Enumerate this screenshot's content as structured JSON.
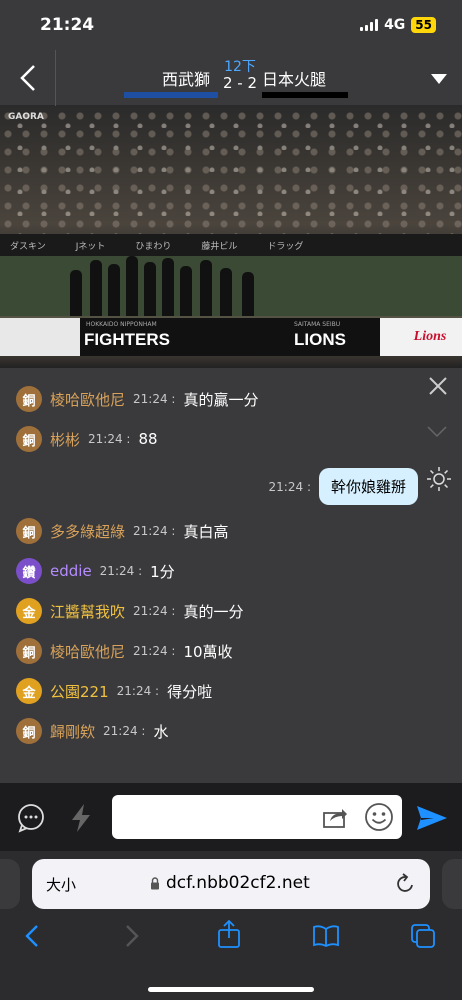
{
  "status": {
    "time": "21:24",
    "network": "4G",
    "battery": "55"
  },
  "header": {
    "inning": "12下",
    "score": "2 - 2",
    "home_team": "西武獅",
    "away_team": "日本火腿",
    "colors": {
      "home_bar": "#1e4fa3",
      "away_bar": "#000000",
      "inning": "#4da6ff"
    }
  },
  "video": {
    "broadcaster": "GAORA",
    "ads": [
      "ダスキン",
      "Jネット",
      "ひまわり",
      "藤井ビル",
      "ドラッグ"
    ],
    "scorebug": {
      "home_sub": "HOKKAIDO NIPPONHAM",
      "home": "FIGHTERS",
      "away_sub": "SAITAMA SEIBU",
      "away": "LIONS",
      "logo": "Lions"
    }
  },
  "chat": {
    "messages": [
      {
        "badge": "銅",
        "badge_color": "#a0703a",
        "user": "棱哈歐他尼",
        "user_color": "#d8a25a",
        "time": "21:24",
        "text": "真的贏一分"
      },
      {
        "badge": "銅",
        "badge_color": "#a0703a",
        "user": "彬彬",
        "user_color": "#d8a25a",
        "time": "21:24",
        "text": "88"
      },
      {
        "badge": "銅",
        "badge_color": "#a0703a",
        "user": "多多綠超綠",
        "user_color": "#d8a25a",
        "time": "21:24",
        "text": "真白高"
      },
      {
        "badge": "鑽",
        "badge_color": "#7b4fc9",
        "user": "eddie",
        "user_color": "#b48cff",
        "time": "21:24",
        "text": "1分"
      },
      {
        "badge": "金",
        "badge_color": "#e0a020",
        "user": "江醬幫我吹",
        "user_color": "#f0c040",
        "time": "21:24",
        "text": "真的一分"
      },
      {
        "badge": "銅",
        "badge_color": "#a0703a",
        "user": "棱哈歐他尼",
        "user_color": "#d8a25a",
        "time": "21:24",
        "text": "10萬收"
      },
      {
        "badge": "金",
        "badge_color": "#e0a020",
        "user": "公園221",
        "user_color": "#f0c040",
        "time": "21:24",
        "text": "得分啦"
      },
      {
        "badge": "銅",
        "badge_color": "#a0703a",
        "user": "歸剛欸",
        "user_color": "#d8a25a",
        "time": "21:24",
        "text": "水"
      }
    ],
    "my_message": {
      "time": "21:24",
      "text": "幹你娘雞掰"
    }
  },
  "input": {
    "placeholder": ""
  },
  "browser": {
    "text_size": "大小",
    "url": "dcf.nbb02cf2.net"
  },
  "icons": {
    "back": "chevron-left-icon",
    "dropdown": "triangle-down-icon",
    "close": "close-icon",
    "collapse": "chevron-down-icon",
    "brightness": "sun-icon",
    "chat": "chat-bubble-icon",
    "lightning": "lightning-icon",
    "share": "share-icon",
    "emoji": "smiley-icon",
    "send": "send-icon",
    "lock": "lock-icon",
    "reload": "reload-icon",
    "nav_back": "chevron-left-icon",
    "nav_forward": "chevron-right-icon",
    "share_sheet": "share-icon",
    "bookmarks": "book-icon",
    "tabs": "tabs-icon"
  }
}
